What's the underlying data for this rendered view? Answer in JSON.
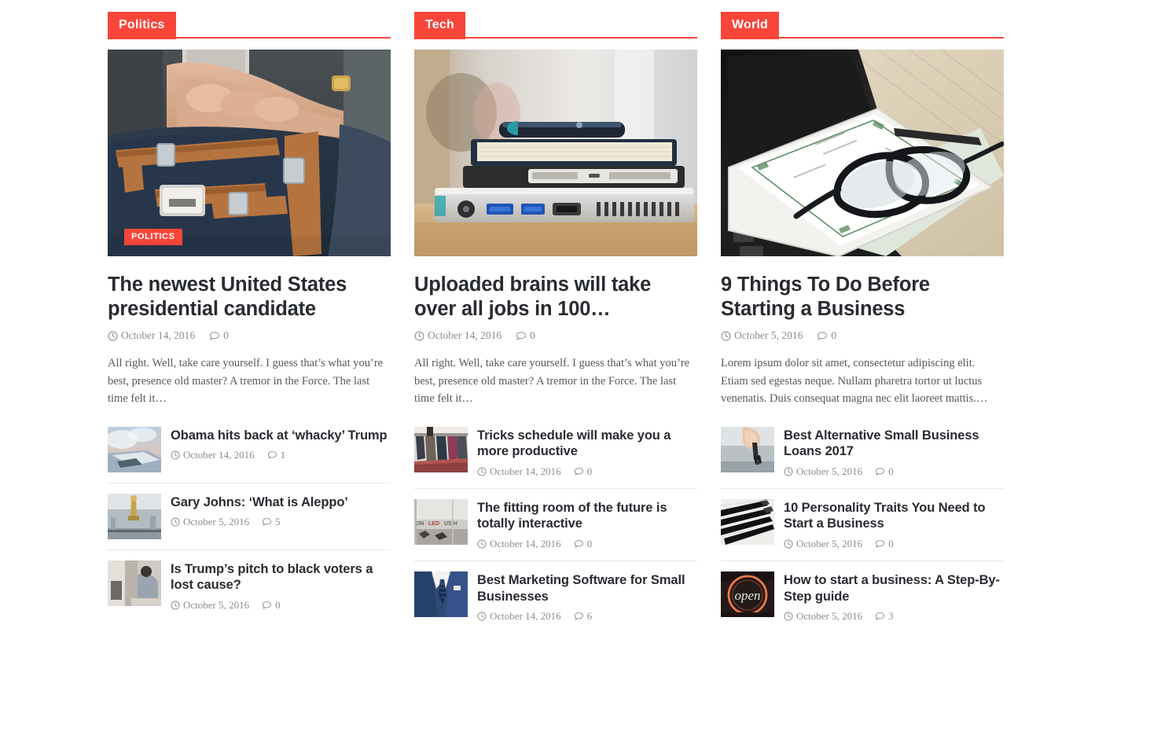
{
  "theme": {
    "accent_color": "#f8453a",
    "title_color": "#282c31",
    "meta_color": "#8d8d8d",
    "text_color": "#55595e"
  },
  "icons": {
    "clock": "clock-icon",
    "comment": "comment-icon"
  },
  "columns": [
    {
      "id": "politics",
      "category_label": "Politics",
      "featured": {
        "image_badge": "POLITICS",
        "image_alt": "person-holding-phone-over-backpack",
        "title": "The newest United States presidential candidate",
        "date": "October 14, 2016",
        "comments": "0",
        "excerpt": "All right. Well, take care yourself. I guess that’s what you’re best, presence old master? A tremor in the Force. The last time felt it…"
      },
      "posts": [
        {
          "title": "Obama hits back at ‘whacky’ Trump",
          "date": "October 14, 2016",
          "comments": "1",
          "image_alt": "airplane-wing-above-clouds"
        },
        {
          "title": "Gary Johns: ‘What is Aleppo’",
          "date": "October 5, 2016",
          "comments": "5",
          "image_alt": "statue-overlooking-city"
        },
        {
          "title": "Is Trump’s pitch to black voters a lost cause?",
          "date": "October 5, 2016",
          "comments": "0",
          "image_alt": "man-writing-at-desk"
        }
      ]
    },
    {
      "id": "tech",
      "category_label": "Tech",
      "featured": {
        "image_badge": "",
        "image_alt": "stack-of-laptop-tablet-notebook-phone",
        "title": "Uploaded brains will take over all jobs in 100…",
        "date": "October 14, 2016",
        "comments": "0",
        "excerpt": "All right. Well, take care yourself. I guess that’s what you’re best, presence old master? A tremor in the Force. The last time felt it…"
      },
      "posts": [
        {
          "title": "Tricks schedule will make you a more productive",
          "date": "October 14, 2016",
          "comments": "0",
          "image_alt": "clothes-on-rack"
        },
        {
          "title": "The fitting room of the future is totally interactive",
          "date": "October 14, 2016",
          "comments": "0",
          "image_alt": "store-window-with-sign"
        },
        {
          "title": "Best Marketing Software for Small Businesses",
          "date": "October 14, 2016",
          "comments": "6",
          "image_alt": "man-in-blue-suit-and-tie"
        }
      ]
    },
    {
      "id": "world",
      "category_label": "World",
      "featured": {
        "image_badge": "",
        "image_alt": "glasses-on-book-over-laptop",
        "title": "9 Things To Do Before Starting a Business",
        "date": "October 5, 2016",
        "comments": "0",
        "excerpt": "Lorem ipsum dolor sit amet, consectetur adipiscing elit. Etiam sed egestas neque. Nullam pharetra tortor ut luctus venenatis. Duis consequat magna nec elit laoreet mattis.…"
      },
      "posts": [
        {
          "title": "Best Alternative Small Business Loans 2017",
          "date": "October 5, 2016",
          "comments": "0",
          "image_alt": "hand-holding-car-keys"
        },
        {
          "title": "10 Personality Traits You Need to Start a Business",
          "date": "October 5, 2016",
          "comments": "0",
          "image_alt": "black-pens-on-notebook"
        },
        {
          "title": "How to start a business: A Step-By-Step guide",
          "date": "October 5, 2016",
          "comments": "3",
          "image_alt": "neon-open-sign"
        }
      ]
    }
  ]
}
